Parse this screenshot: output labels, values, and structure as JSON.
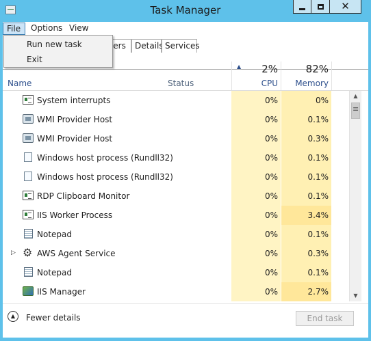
{
  "window": {
    "title": "Task Manager"
  },
  "menu": {
    "file": "File",
    "options": "Options",
    "view": "View"
  },
  "file_menu": {
    "run_new_task": "Run new task",
    "exit": "Exit"
  },
  "tabs": {
    "users": "sers",
    "details": "Details",
    "services": "Services"
  },
  "columns": {
    "name": "Name",
    "status": "Status",
    "cpu_total": "2%",
    "cpu_label": "CPU",
    "memory_total": "82%",
    "memory_label": "Memory"
  },
  "processes": [
    {
      "name": "System interrupts",
      "cpu": "0%",
      "memory": "0%",
      "icon": "app-window-icon"
    },
    {
      "name": "WMI Provider Host",
      "cpu": "0%",
      "memory": "0.1%",
      "icon": "wmi-icon"
    },
    {
      "name": "WMI Provider Host",
      "cpu": "0%",
      "memory": "0.3%",
      "icon": "wmi-icon"
    },
    {
      "name": "Windows host process (Rundll32)",
      "cpu": "0%",
      "memory": "0.1%",
      "icon": "document-icon"
    },
    {
      "name": "Windows host process (Rundll32)",
      "cpu": "0%",
      "memory": "0.1%",
      "icon": "document-icon"
    },
    {
      "name": "RDP Clipboard Monitor",
      "cpu": "0%",
      "memory": "0.1%",
      "icon": "app-window-icon"
    },
    {
      "name": "IIS Worker Process",
      "cpu": "0%",
      "memory": "3.4%",
      "icon": "app-window-icon"
    },
    {
      "name": "Notepad",
      "cpu": "0%",
      "memory": "0.1%",
      "icon": "notepad-icon"
    },
    {
      "name": "AWS Agent Service",
      "cpu": "0%",
      "memory": "0.3%",
      "icon": "service-icon"
    },
    {
      "name": "Notepad",
      "cpu": "0%",
      "memory": "0.1%",
      "icon": "notepad-icon"
    },
    {
      "name": "IIS Manager",
      "cpu": "0%",
      "memory": "2.7%",
      "icon": "iis-icon"
    }
  ],
  "footer": {
    "fewer_details": "Fewer details",
    "end_task": "End task"
  }
}
